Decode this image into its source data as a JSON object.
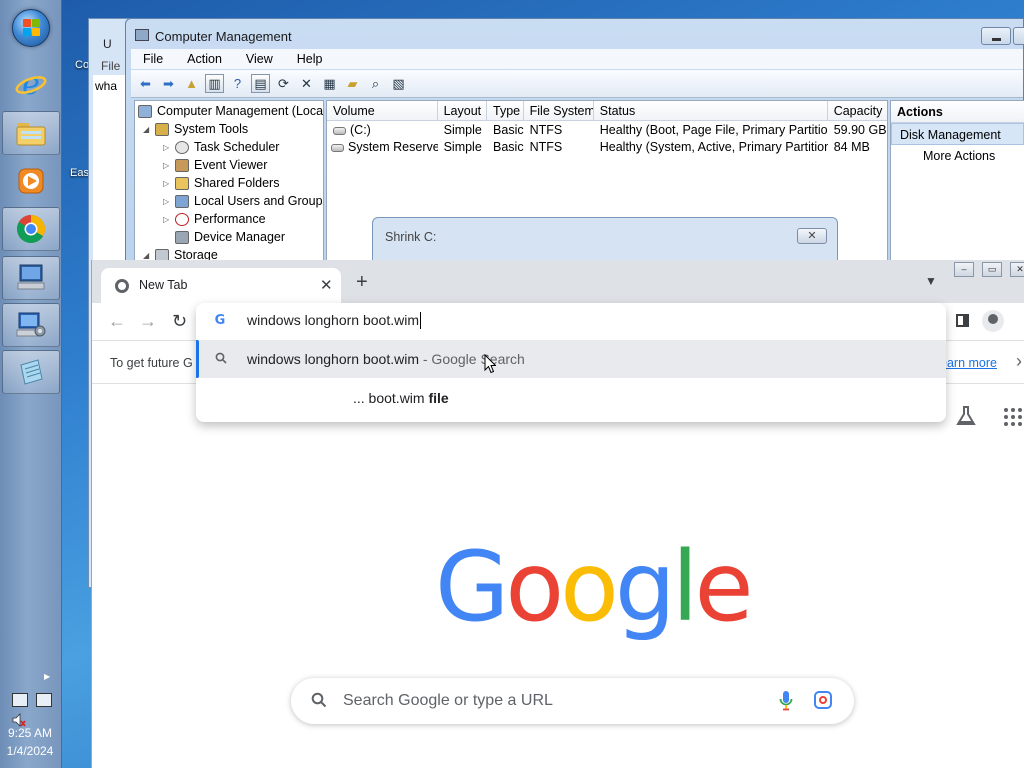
{
  "taskbar": {
    "clock_time": "9:25 AM",
    "clock_date": "1/4/2024",
    "pinned": [
      "internet-explorer",
      "windows-explorer",
      "media-player",
      "google-chrome",
      "remote-desktop",
      "computer-management",
      "notepad"
    ]
  },
  "background_window": {
    "title": "U",
    "menu_first": "File",
    "text": "wha",
    "desktop_labels": [
      "Co",
      "Eas"
    ]
  },
  "computer_management": {
    "title": "Computer Management",
    "menu": [
      "File",
      "Action",
      "View",
      "Help"
    ],
    "tree": [
      {
        "label": "Computer Management (Local",
        "indent": 0,
        "arrow": ""
      },
      {
        "label": "System Tools",
        "indent": 1,
        "arrow": "◢"
      },
      {
        "label": "Task Scheduler",
        "indent": 2,
        "arrow": "▷"
      },
      {
        "label": "Event Viewer",
        "indent": 2,
        "arrow": "▷"
      },
      {
        "label": "Shared Folders",
        "indent": 2,
        "arrow": "▷"
      },
      {
        "label": "Local Users and Groups",
        "indent": 2,
        "arrow": "▷"
      },
      {
        "label": "Performance",
        "indent": 2,
        "arrow": "▷"
      },
      {
        "label": "Device Manager",
        "indent": 2,
        "arrow": ""
      },
      {
        "label": "Storage",
        "indent": 1,
        "arrow": "◢"
      }
    ],
    "columns": [
      "Volume",
      "Layout",
      "Type",
      "File System",
      "Status",
      "Capacity"
    ],
    "rows": [
      [
        "(C:)",
        "Simple",
        "Basic",
        "NTFS",
        "Healthy (Boot, Page File, Primary Partition)",
        "59.90 GB"
      ],
      [
        "System Reserved",
        "Simple",
        "Basic",
        "NTFS",
        "Healthy (System, Active, Primary Partition)",
        "84 MB"
      ]
    ],
    "actions": {
      "header": "Actions",
      "selected": "Disk Management",
      "more": "More Actions"
    },
    "shrink_dialog": {
      "title": "Shrink C:",
      "close": "✕"
    }
  },
  "chrome": {
    "tab_title": "New Tab",
    "tab_close": "✕",
    "new_tab": "+",
    "infobar": {
      "text": "To get future G",
      "link": "earn more"
    },
    "omnibox": {
      "value": "windows longhorn boot.wim",
      "suggestions": [
        {
          "main": "windows longhorn boot.wim",
          "sub": " - Google Search",
          "bold": ""
        },
        {
          "main": "... boot.wim ",
          "sub": "",
          "bold": "file"
        }
      ]
    },
    "ntp": {
      "logo_letters": [
        "G",
        "o",
        "o",
        "g",
        "l",
        "e"
      ],
      "logo_colors": [
        "#4285f4",
        "#ea4335",
        "#fbbc05",
        "#4285f4",
        "#34a853",
        "#ea4335"
      ],
      "search_placeholder": "Search Google or type a URL"
    }
  }
}
